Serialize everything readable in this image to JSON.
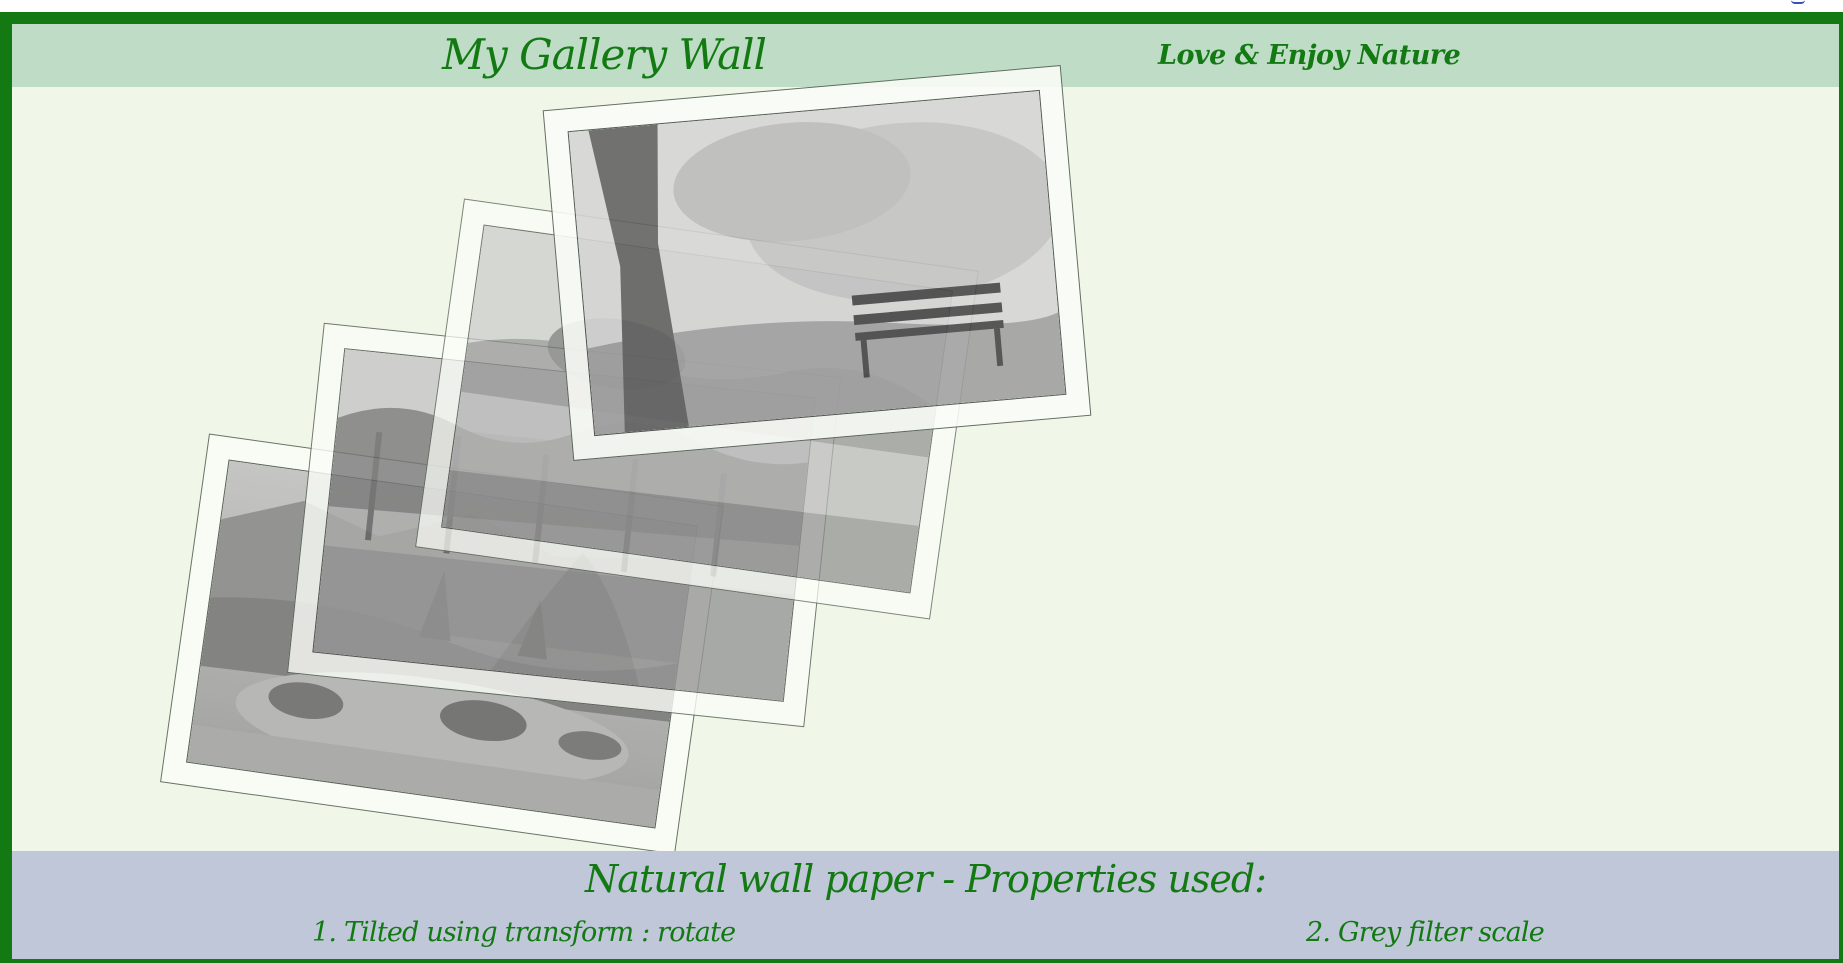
{
  "header": {
    "title": "My Gallery Wall",
    "tagline": "Love & Enjoy Nature"
  },
  "gallery": {
    "photos": [
      {
        "subject": "tree-and-bench-in-fog"
      },
      {
        "subject": "lake-with-hills"
      },
      {
        "subject": "park-trees-path"
      },
      {
        "subject": "garden-pond-rocks"
      }
    ]
  },
  "footer": {
    "heading": "Natural wall paper - Properties used:",
    "properties": [
      "1. Tilted using transform : rotate",
      "2. Grey filter scale"
    ]
  },
  "colors": {
    "frame_border": "#137a13",
    "header_bg": "#bfdcc6",
    "page_bg": "#f0f7e8",
    "footer_bg": "#c0c7d9",
    "text": "#137a13"
  },
  "icons": [
    "photo-image"
  ]
}
